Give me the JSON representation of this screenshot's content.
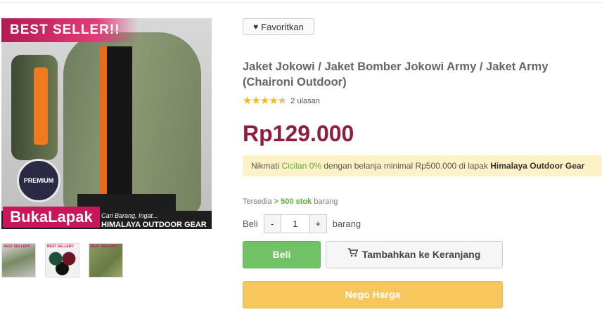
{
  "image": {
    "overlay_label": "BEST SELLER!!",
    "badge_text": "PREMIUM",
    "brand_logo": "BukaLapak",
    "brand_tagline": "Cari Barang, Ingat...",
    "brand_store": "HIMALAYA OUTDOOR GEAR",
    "thumbnails": [
      {
        "label": "BEST SELLER!!",
        "selected": false
      },
      {
        "label": "BEST SELLER!!",
        "selected": false
      },
      {
        "label": "BEST SELLER!!",
        "selected": false
      }
    ]
  },
  "product": {
    "favorite_label": "Favoritkan",
    "favorite_icon": "heart-icon",
    "title": "Jaket Jokowi / Jaket Bomber Jokowi Army / Jaket Army (Chaironi Outdoor)",
    "rating": 4.5,
    "rating_max": 5,
    "review_count": "2 ulasan",
    "price": "Rp129.000",
    "promo": {
      "prefix": "Nikmati ",
      "highlight": "Cicilan 0%",
      "middle": " dengan belanja minimal Rp500.000 di lapak ",
      "store": "Himalaya Outdoor Gear"
    },
    "stock": {
      "prefix": "Tersedia",
      "arrow": " > ",
      "amount": "500 stok",
      "suffix": " barang"
    },
    "quantity": {
      "label": "Beli",
      "minus": "-",
      "value": "1",
      "plus": "+",
      "unit": "barang"
    },
    "buy_label": "Beli",
    "cart_label": "Tambahkan ke Keranjang",
    "cart_icon": "cart-icon",
    "nego_label": "Nego Harga"
  },
  "colors": {
    "price": "#8f1d3c",
    "buy_button": "#71c167",
    "nego_button": "#f7c75e",
    "promo_bg": "#fdf2c6",
    "highlight_green": "#5cab3a",
    "star": "#f7bb0b"
  }
}
